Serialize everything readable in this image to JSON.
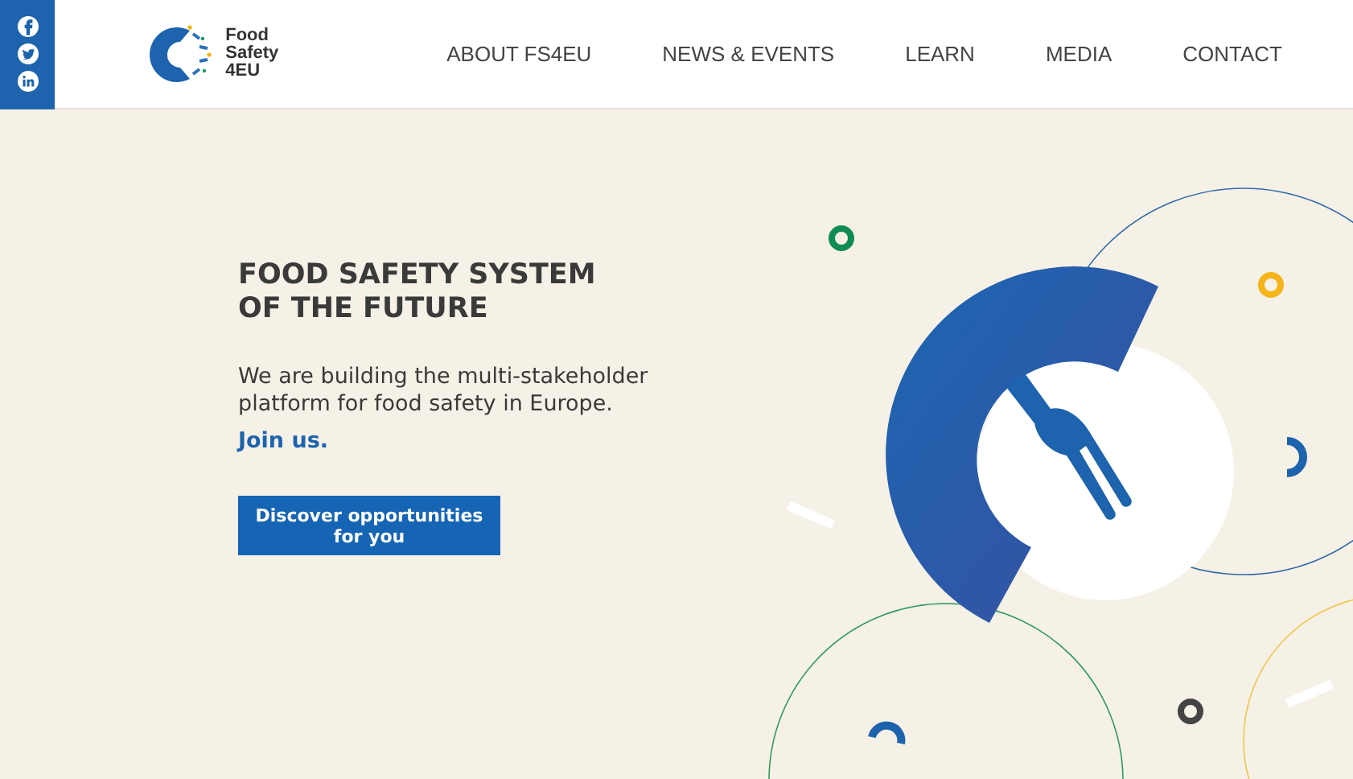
{
  "social": [
    {
      "kind": "facebook"
    },
    {
      "kind": "twitter"
    },
    {
      "kind": "linkedin"
    }
  ],
  "logo": {
    "lines": [
      "Food",
      "Safety",
      "4EU"
    ]
  },
  "nav": [
    {
      "label": "ABOUT FS4EU"
    },
    {
      "label": "NEWS & EVENTS"
    },
    {
      "label": "LEARN"
    },
    {
      "label": "MEDIA"
    },
    {
      "label": "CONTACT"
    }
  ],
  "hero": {
    "title_lines": [
      "FOOD SAFETY SYSTEM",
      "OF THE FUTURE"
    ],
    "text": "We are building the multi-stakeholder platform for food safety in Europe.",
    "link": "Join us.",
    "button": "Discover opportunities for you"
  }
}
